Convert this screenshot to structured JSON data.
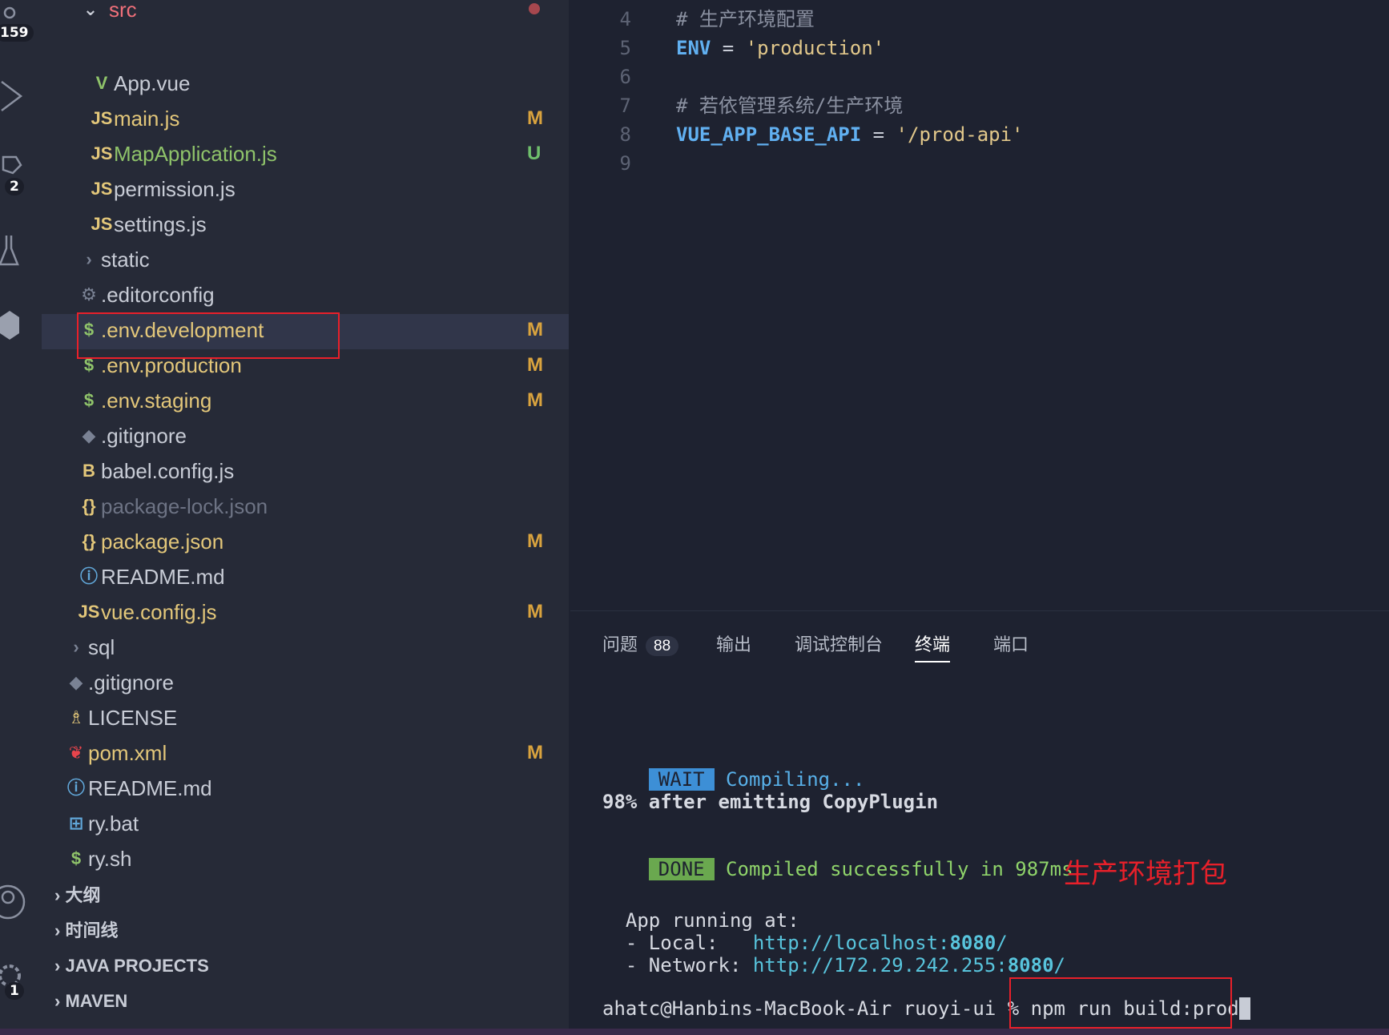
{
  "activity_bar": {
    "badges": [
      "159",
      "2",
      "1"
    ]
  },
  "explorer": {
    "src_folder": "src",
    "files": [
      {
        "name": "App.vue",
        "icon": "vue-icon",
        "glyph": "V",
        "color": "#c8ccd6",
        "indent": 142,
        "status": ""
      },
      {
        "name": "main.js",
        "icon": "js-icon",
        "glyph": "JS",
        "color": "#e3c77a",
        "indent": 142,
        "status": "M"
      },
      {
        "name": "MapApplication.js",
        "icon": "js-icon",
        "glyph": "JS",
        "color": "#8fc36a",
        "indent": 142,
        "status": "U"
      },
      {
        "name": "permission.js",
        "icon": "js-icon",
        "glyph": "JS",
        "color": "#c8ccd6",
        "indent": 142,
        "status": ""
      },
      {
        "name": "settings.js",
        "icon": "js-icon",
        "glyph": "JS",
        "color": "#c8ccd6",
        "indent": 142,
        "status": ""
      },
      {
        "name": "static",
        "icon": "chevron-right-icon",
        "glyph": "›",
        "color": "#c8ccd6",
        "indent": 126,
        "status": ""
      },
      {
        "name": ".editorconfig",
        "icon": "gear-icon",
        "glyph": "⚙",
        "color": "#c8ccd6",
        "indent": 126,
        "status": ""
      },
      {
        "name": ".env.development",
        "icon": "dollar-icon",
        "glyph": "$",
        "color": "#e3c77a",
        "indent": 126,
        "status": "M"
      },
      {
        "name": ".env.production",
        "icon": "dollar-icon",
        "glyph": "$",
        "color": "#e3c77a",
        "indent": 126,
        "status": "M"
      },
      {
        "name": ".env.staging",
        "icon": "dollar-icon",
        "glyph": "$",
        "color": "#e3c77a",
        "indent": 126,
        "status": "M"
      },
      {
        "name": ".gitignore",
        "icon": "git-icon",
        "glyph": "◆",
        "color": "#c8ccd6",
        "indent": 126,
        "status": ""
      },
      {
        "name": "babel.config.js",
        "icon": "babel-icon",
        "glyph": "B",
        "color": "#c8ccd6",
        "indent": 126,
        "status": ""
      },
      {
        "name": "package-lock.json",
        "icon": "json-icon",
        "glyph": "{}",
        "color": "#6d7384",
        "indent": 126,
        "status": ""
      },
      {
        "name": "package.json",
        "icon": "json-icon",
        "glyph": "{}",
        "color": "#e3c77a",
        "indent": 126,
        "status": "M"
      },
      {
        "name": "README.md",
        "icon": "info-icon",
        "glyph": "ⓘ",
        "color": "#c8ccd6",
        "indent": 126,
        "status": ""
      },
      {
        "name": "vue.config.js",
        "icon": "js-icon",
        "glyph": "JS",
        "color": "#e3c77a",
        "indent": 126,
        "status": "M"
      },
      {
        "name": "sql",
        "icon": "chevron-right-icon",
        "glyph": "›",
        "color": "#c8ccd6",
        "indent": 110,
        "status": ""
      },
      {
        "name": ".gitignore",
        "icon": "git-icon",
        "glyph": "◆",
        "color": "#c8ccd6",
        "indent": 110,
        "status": ""
      },
      {
        "name": "LICENSE",
        "icon": "license-icon",
        "glyph": "♗",
        "color": "#c8ccd6",
        "indent": 110,
        "status": ""
      },
      {
        "name": "pom.xml",
        "icon": "maven-icon",
        "glyph": "❦",
        "color": "#e3c77a",
        "indent": 110,
        "status": "M"
      },
      {
        "name": "README.md",
        "icon": "info-icon",
        "glyph": "ⓘ",
        "color": "#c8ccd6",
        "indent": 110,
        "status": ""
      },
      {
        "name": "ry.bat",
        "icon": "windows-icon",
        "glyph": "⊞",
        "color": "#c8ccd6",
        "indent": 110,
        "status": ""
      },
      {
        "name": "ry.sh",
        "icon": "dollar-icon",
        "glyph": "$",
        "color": "#c8ccd6",
        "indent": 110,
        "status": ""
      }
    ],
    "sections": [
      "大纲",
      "时间线",
      "JAVA PROJECTS",
      "MAVEN"
    ]
  },
  "editor": {
    "lines": [
      {
        "num": "4",
        "type": "comment",
        "text": "# 生产环境配置"
      },
      {
        "num": "5",
        "type": "assign",
        "key": "ENV",
        "op": " = ",
        "value": "'production'"
      },
      {
        "num": "6",
        "type": "blank",
        "text": ""
      },
      {
        "num": "7",
        "type": "comment",
        "text": "# 若依管理系统/生产环境"
      },
      {
        "num": "8",
        "type": "assign",
        "key": "VUE_APP_BASE_API",
        "op": " = ",
        "value": "'/prod-api'"
      },
      {
        "num": "9",
        "type": "blank",
        "text": ""
      }
    ]
  },
  "panel": {
    "tabs": [
      {
        "label": "问题",
        "count": "88"
      },
      {
        "label": "输出"
      },
      {
        "label": "调试控制台"
      },
      {
        "label": "终端",
        "active": true
      },
      {
        "label": "端口"
      }
    ],
    "terminal": {
      "wait_tag": "WAIT",
      "wait_text": "Compiling...",
      "progress": "98% after emitting CopyPlugin",
      "done_tag": "DONE",
      "done_text": "Compiled successfully in 987ms",
      "running_at": "  App running at:",
      "local_label": "  - Local:   ",
      "local_url": "http://localhost:",
      "local_port": "8080",
      "local_slash": "/",
      "network_label": "  - Network: ",
      "network_url": "http://172.29.242.255:",
      "network_port": "8080",
      "network_slash": "/",
      "prompt": "ahatc@Hanbins-MacBook-Air ruoyi-ui % ",
      "command": "npm run build:prod"
    },
    "annotation": "生产环境打包"
  },
  "colors": {
    "wait_bg": "#3d8fd6",
    "done_bg": "#6aa84f",
    "url": "#58c4dc",
    "annotation": "#e8202a",
    "highlight_box": "#e8202a"
  }
}
